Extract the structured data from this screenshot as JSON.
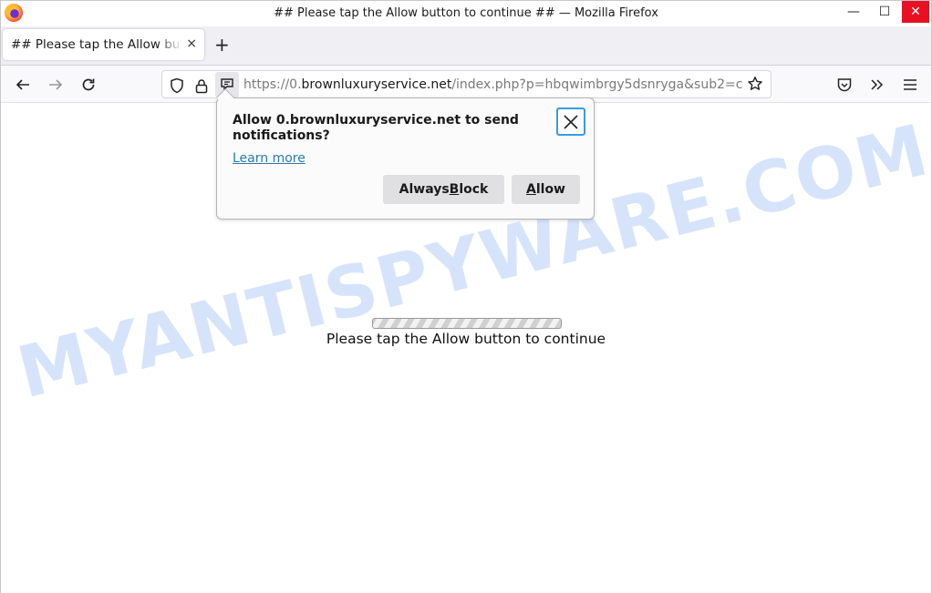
{
  "window": {
    "title": "## Please tap the Allow button to continue ## — Mozilla Firefox",
    "controls": {
      "minimize": "—",
      "maximize": "☐",
      "close": "✕"
    }
  },
  "tabs": [
    {
      "title": "## Please tap the Allow button to continue ##",
      "close": "×",
      "active": true
    }
  ],
  "new_tab_label": "+",
  "navbar": {
    "url_prefix": "https://0.",
    "url_host": "brownluxuryservice.net",
    "url_path": "/index.php?p=hbqwimbrgy5dsnryga&sub2=c",
    "icons": [
      "back-icon",
      "forward-icon",
      "reload-icon",
      "shield-icon",
      "lock-icon",
      "notification-permission-icon",
      "bookmark-star-icon",
      "pocket-icon",
      "overflow-icon",
      "menu-icon"
    ]
  },
  "popup": {
    "message": "Allow 0.brownluxuryservice.net to send notifications?",
    "learn_more": "Learn more",
    "block_pre": "Always ",
    "block_key": "B",
    "block_post": "lock",
    "allow_key": "A",
    "allow_post": "llow"
  },
  "page": {
    "message": "Please tap the Allow button to continue",
    "watermark": "MYANTISPYWARE.COM",
    "progress_state": "indeterminate"
  }
}
